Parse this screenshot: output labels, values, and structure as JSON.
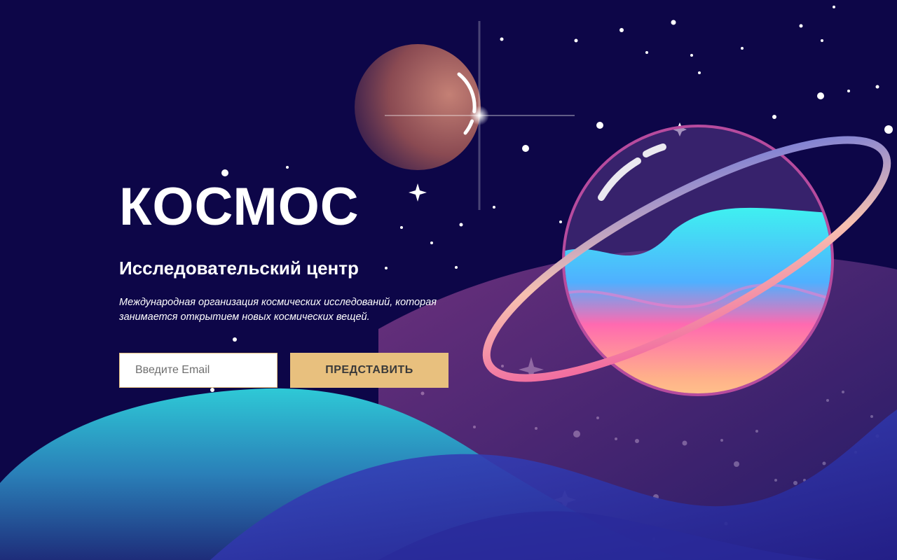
{
  "hero": {
    "title": "КОСМОС",
    "subtitle": "Исследовательский центр",
    "description": "Международная организация космических исследований, которая занимается открытием новых космических вещей."
  },
  "signup": {
    "email_placeholder": "Введите Email",
    "submit_label": "ПРЕДСТАВИТЬ"
  },
  "colors": {
    "background": "#0d0648",
    "button": "#e8c07e",
    "text": "#ffffff"
  }
}
